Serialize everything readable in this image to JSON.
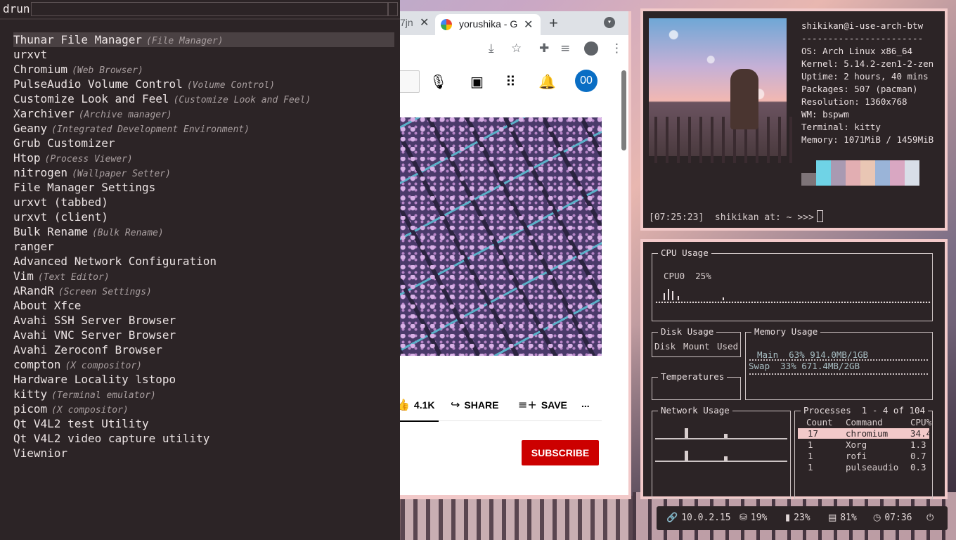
{
  "rofi": {
    "prompt": "drun",
    "query": "",
    "items": [
      {
        "name": "Thunar File Manager",
        "desc": "(File Manager)"
      },
      {
        "name": "urxvt",
        "desc": ""
      },
      {
        "name": "Chromium",
        "desc": "(Web Browser)"
      },
      {
        "name": "PulseAudio Volume Control",
        "desc": "(Volume Control)"
      },
      {
        "name": "Customize Look and Feel",
        "desc": "(Customize Look and Feel)"
      },
      {
        "name": "Xarchiver",
        "desc": "(Archive manager)"
      },
      {
        "name": "Geany",
        "desc": "(Integrated Development Environment)"
      },
      {
        "name": "Grub Customizer",
        "desc": ""
      },
      {
        "name": "Htop",
        "desc": "(Process Viewer)"
      },
      {
        "name": "nitrogen",
        "desc": "(Wallpaper Setter)"
      },
      {
        "name": "File Manager Settings",
        "desc": ""
      },
      {
        "name": "urxvt (tabbed)",
        "desc": ""
      },
      {
        "name": "urxvt (client)",
        "desc": ""
      },
      {
        "name": "Bulk Rename",
        "desc": "(Bulk Rename)"
      },
      {
        "name": "ranger",
        "desc": ""
      },
      {
        "name": "Advanced Network Configuration",
        "desc": ""
      },
      {
        "name": "Vim",
        "desc": "(Text Editor)"
      },
      {
        "name": "ARandR",
        "desc": "(Screen Settings)"
      },
      {
        "name": "About Xfce",
        "desc": ""
      },
      {
        "name": "Avahi SSH Server Browser",
        "desc": ""
      },
      {
        "name": "Avahi VNC Server Browser",
        "desc": ""
      },
      {
        "name": "Avahi Zeroconf Browser",
        "desc": ""
      },
      {
        "name": "compton",
        "desc": "(X compositor)"
      },
      {
        "name": "Hardware Locality lstopo",
        "desc": ""
      },
      {
        "name": "kitty",
        "desc": "(Terminal emulator)"
      },
      {
        "name": "picom",
        "desc": "(X compositor)"
      },
      {
        "name": "Qt V4L2 test Utility",
        "desc": ""
      },
      {
        "name": "Qt V4L2 video capture utility",
        "desc": ""
      },
      {
        "name": "Viewnior",
        "desc": ""
      }
    ]
  },
  "browser": {
    "tab_stub": "7jn",
    "tab_title": "yorushika - G",
    "avatar_initials": "00",
    "likes": "4.1K",
    "share": "SHARE",
    "save": "SAVE",
    "more": "...",
    "subscribe": "SUBSCRIBE"
  },
  "neofetch": {
    "header": "shikikan@i-use-arch-btw",
    "separator": "-----------------------",
    "lines": [
      "OS: Arch Linux x86_64",
      "Kernel: 5.14.2-zen1-2-zen",
      "Uptime: 2 hours, 40 mins",
      "Packages: 507 (pacman)",
      "Resolution: 1360x768",
      "WM: bspwm",
      "Terminal: kitty",
      "Memory: 1071MiB / 1459MiB"
    ],
    "swatches": [
      "#7e7478",
      "#6fd3e6",
      "#a99ab2",
      "#e2aeb2",
      "#e9c6b4",
      "#9ab4d8",
      "#d9a7c2",
      "#d8dee8"
    ],
    "prompt": "[07:25:23]  shikikan at: ~ >>>"
  },
  "monitor": {
    "cpu_title": "CPU Usage",
    "cpu_label": "CPU0  25%",
    "disk_title": "Disk Usage",
    "disk_cols": [
      "Disk",
      "Mount",
      "Used"
    ],
    "mem_title": "Memory Usage",
    "mem_main": "Main  63% 914.0MB/1GB",
    "mem_swap": "Swap  33% 671.4MB/2GB",
    "temp_title": "Temperatures",
    "net_title": "Network Usage",
    "proc_title": "Processes  1 - 4 of 104",
    "proc_cols": [
      "Count",
      "Command",
      "CPU%"
    ],
    "procs": [
      {
        "count": "17",
        "cmd": "chromium",
        "cpu": "34.4"
      },
      {
        "count": "1",
        "cmd": "Xorg",
        "cpu": "1.3"
      },
      {
        "count": "1",
        "cmd": "rofi",
        "cpu": "0.7"
      },
      {
        "count": "1",
        "cmd": "pulseaudio",
        "cpu": "0.3"
      }
    ]
  },
  "statusbar": {
    "ip": "10.0.2.15",
    "disk": "19%",
    "battery": "23%",
    "memory": "81%",
    "time": "07:36"
  }
}
